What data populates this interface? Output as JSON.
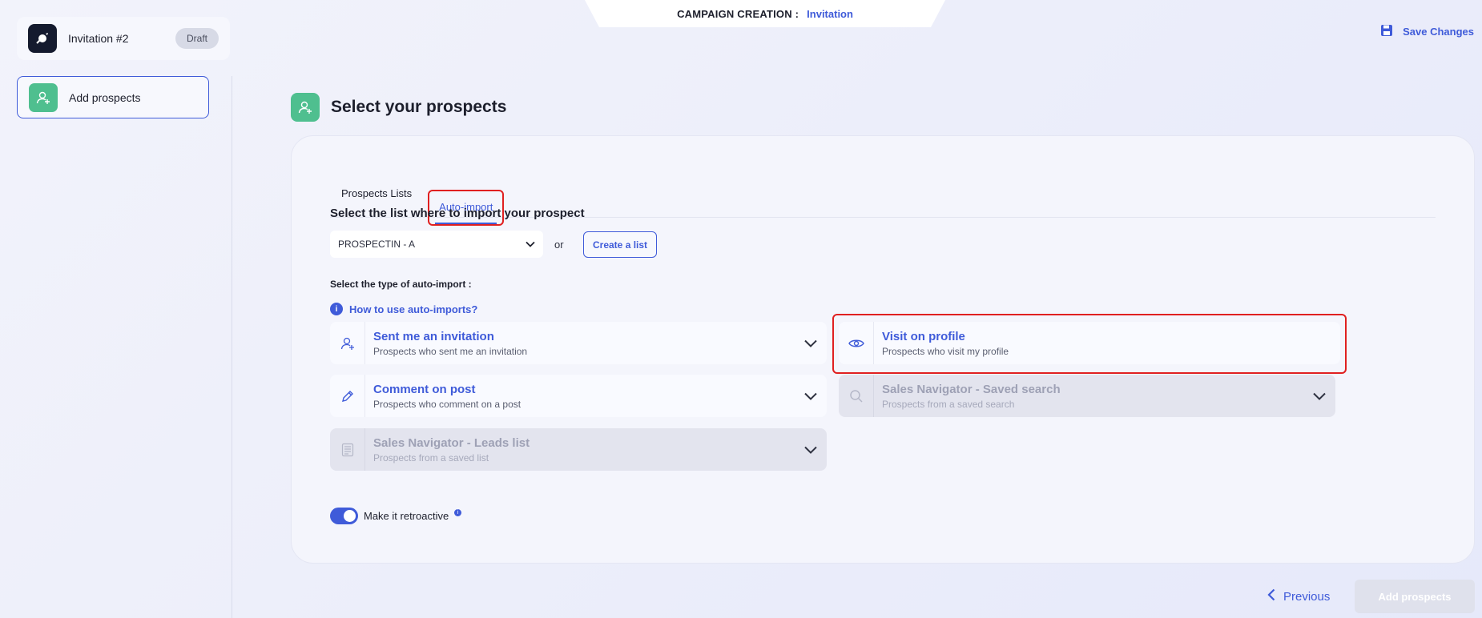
{
  "header": {
    "label": "CAMPAIGN CREATION :",
    "value": "Invitation"
  },
  "campaign": {
    "title": "Invitation #2",
    "status": "Draft"
  },
  "steps": [
    {
      "label": "Add prospects",
      "icon": "add-user-icon"
    }
  ],
  "toolbar": {
    "save_label": "Save Changes"
  },
  "section": {
    "title": "Select your prospects"
  },
  "tabs": [
    {
      "label": "Prospects Lists",
      "active": false
    },
    {
      "label": "Auto-import",
      "active": true
    }
  ],
  "list_select": {
    "label": "Select the list where to import your prospect",
    "value": "PROSPECTIN - A",
    "or_text": "or",
    "create_label": "Create a list"
  },
  "auto_import": {
    "type_label": "Select the type of auto-import :",
    "help_link": "How to use auto-imports?",
    "options": [
      {
        "title": "Sent me an invitation",
        "subtitle": "Prospects who sent me an invitation",
        "icon": "add-user-icon",
        "disabled": false
      },
      {
        "title": "Visit on profile",
        "subtitle": "Prospects who visit my profile",
        "icon": "eye-icon",
        "disabled": false
      },
      {
        "title": "Comment on post",
        "subtitle": "Prospects who comment on a post",
        "icon": "pencil-icon",
        "disabled": false
      },
      {
        "title": "Sales Navigator - Saved search",
        "subtitle": "Prospects from a saved search",
        "icon": "search-icon",
        "disabled": true
      },
      {
        "title": "Sales Navigator - Leads list",
        "subtitle": "Prospects from a saved list",
        "icon": "list-icon",
        "disabled": true
      }
    ]
  },
  "retroactive": {
    "label": "Make it retroactive",
    "enabled": true
  },
  "footer": {
    "previous_label": "Previous",
    "add_label": "Add prospects"
  },
  "colors": {
    "accent": "#3f5bd9",
    "green": "#4fbf8f",
    "highlight": "#e02020"
  }
}
